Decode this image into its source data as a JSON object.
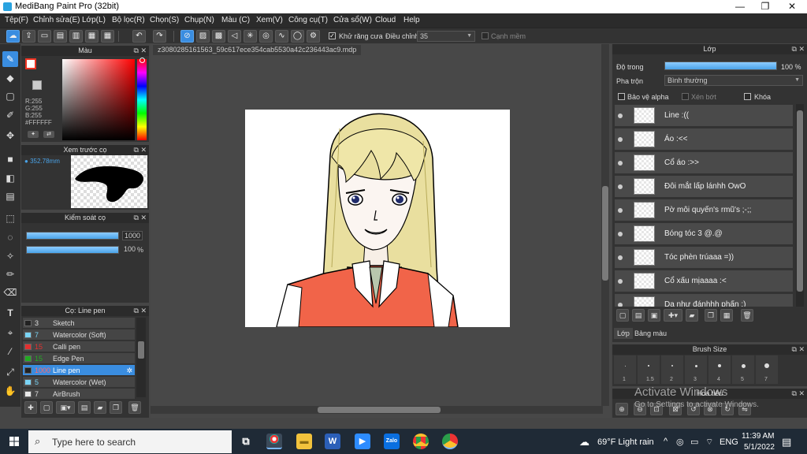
{
  "window": {
    "title": "MediBang Paint Pro (32bit)",
    "controls": {
      "minimize": "—",
      "maximize": "❐",
      "close": "✕"
    }
  },
  "menu": [
    "Tệp(F)",
    "Chỉnh sửa(E)",
    "Lớp(L)",
    "Bộ lọc(R)",
    "Chọn(S)",
    "Chụp(N)",
    "Màu (C)",
    "Xem(V)",
    "Công cụ(T)",
    "Cửa sổ(W)",
    "Cloud",
    "Help"
  ],
  "toolbar": {
    "antialias_label": "Khử răng cưa",
    "antialias_checked": true,
    "correction_label": "Điều chỉnh",
    "correction_value": "35",
    "smooth_edge_label": "Cạnh mềm",
    "smooth_edge_checked": false
  },
  "color_panel": {
    "title": "Màu",
    "rgb_readout": "R:255\nG:255\nB:255\n#FFFFFF",
    "foreground": "#ffffff",
    "accent_outline": "#e32222"
  },
  "preview_panel": {
    "title": "Xem trước cọ",
    "size": "352.78mm"
  },
  "brush_control": {
    "title": "Kiểm soát cọ",
    "size_value": "1000",
    "opacity_value": "100",
    "opacity_unit": "%"
  },
  "brush_list": {
    "title": "Cọ: Line pen",
    "items": [
      {
        "size": "3",
        "name": "Sketch",
        "color": "#222222"
      },
      {
        "size": "7",
        "name": "Watercolor (Soft)",
        "color": "#7ad4f5"
      },
      {
        "size": "15",
        "name": "Calli pen",
        "color": "#e23030"
      },
      {
        "size": "15",
        "name": "Edge Pen",
        "color": "#22aa22"
      },
      {
        "size": "1000",
        "name": "Line pen",
        "color": "#222222",
        "selected": true
      },
      {
        "size": "5",
        "name": "Watercolor (Wet)",
        "color": "#7ad4f5"
      },
      {
        "size": "7",
        "name": "AirBrush",
        "color": "#e8e8e8"
      }
    ]
  },
  "document": {
    "tab": "z3080285161563_59c617ece354cab5530a42c236443ac9.mdp"
  },
  "layer_panel": {
    "title": "Lớp",
    "opacity_label": "Độ trong",
    "opacity_value": "100 %",
    "opacity": 1.0,
    "blend_label": "Pha trộn",
    "blend_value": "Bình thường",
    "protect_alpha": "Bảo vệ alpha",
    "clipping": "Xén bớt",
    "lock": "Khóa",
    "layers": [
      "Line :((",
      "Áo :<<",
      "Cổ áo :>>",
      "Đôi mắt lấp lánhh OwO",
      "Pờ môi quyến's rmũ's ;-;;",
      "Bóng tóc 3 @.@",
      "Tóc phèn trúaaa =))",
      "Cổ xấu mịaaaa :<",
      "Da như đánhhh phấn :)"
    ],
    "tabs": [
      "Lớp",
      "Bảng màu"
    ]
  },
  "brush_size": {
    "title": "Brush Size",
    "sizes": [
      "1",
      "1.5",
      "2",
      "3",
      "4",
      "5",
      "7"
    ]
  },
  "nav_panel": {
    "title": "Hoa tiêu"
  },
  "watermark": {
    "line1": "Activate Windows",
    "line2": "Go to Settings to activate Windows."
  },
  "taskbar": {
    "search_placeholder": "Type here to search",
    "weather": "69°F  Light rain",
    "lang": "ENG",
    "time": "11:39 AM",
    "date": "5/1/2022",
    "caret": "^"
  }
}
